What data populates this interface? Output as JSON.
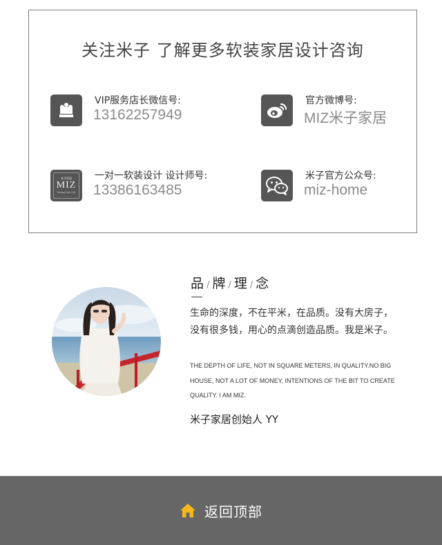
{
  "contact": {
    "title": "关注米子 了解更多软装家居设计咨询",
    "items": [
      {
        "label": "VIP服务店长微信号:",
        "value": "13162257949",
        "icon": "crown-icon"
      },
      {
        "label": "官方微博号:",
        "value": "MIZ米子家居",
        "icon": "weibo-icon"
      },
      {
        "label": "一对一软装设计 设计师号:",
        "value": "13386163485",
        "icon": "miz-logo"
      },
      {
        "label": "米子官方公众号:",
        "value": "miz-home",
        "icon": "wechat-icon"
      }
    ],
    "miz_logo": {
      "top": "米子家居",
      "main": "MIZ",
      "script": "Tasting Your Life"
    }
  },
  "brand": {
    "title_chars": [
      "品",
      "牌",
      "理",
      "念"
    ],
    "title_sep": "/",
    "text_cn": "生命的深度，不在平米，在品质。没有大房子，没有很多钱，用心的点滴创造品质。我是米子。",
    "text_en": "THE DEPTH OF LIFE, NOT IN SQUARE METERS, IN QUALITY.NO BIG HOUSE, NOT A LOT  OF MONEY, INTENTIONS OF THE BIT TO CREATE QUALITY. I AM MIZ.",
    "founder": "米子家居创始人   YY"
  },
  "footer": {
    "label": "返回顶部",
    "icon": "home-icon",
    "icon_color": "#f5b81b"
  },
  "colors": {
    "footer_bg": "#666666",
    "icon_tile": "#555555",
    "value_text": "#8a8a8a"
  }
}
